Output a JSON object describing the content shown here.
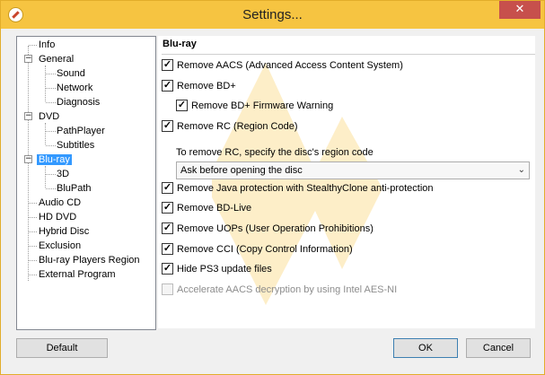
{
  "window": {
    "title": "Settings...",
    "close_glyph": "✕"
  },
  "tree": {
    "items": [
      {
        "label": "Info",
        "level": 0
      },
      {
        "label": "General",
        "level": 0,
        "expander": "−"
      },
      {
        "label": "Sound",
        "level": 1
      },
      {
        "label": "Network",
        "level": 1
      },
      {
        "label": "Diagnosis",
        "level": 1
      },
      {
        "label": "DVD",
        "level": 0,
        "expander": "−"
      },
      {
        "label": "PathPlayer",
        "level": 1
      },
      {
        "label": "Subtitles",
        "level": 1
      },
      {
        "label": "Blu-ray",
        "level": 0,
        "expander": "−",
        "selected": true
      },
      {
        "label": "3D",
        "level": 1
      },
      {
        "label": "BluPath",
        "level": 1
      },
      {
        "label": "Audio CD",
        "level": 0
      },
      {
        "label": "HD DVD",
        "level": 0
      },
      {
        "label": "Hybrid Disc",
        "level": 0
      },
      {
        "label": "Exclusion",
        "level": 0
      },
      {
        "label": "Blu-ray Players Region",
        "level": 0
      },
      {
        "label": "External Program",
        "level": 0
      }
    ]
  },
  "panel": {
    "title": "Blu-ray",
    "options": [
      {
        "label": "Remove AACS (Advanced Access Content System)",
        "checked": true
      },
      {
        "label": "Remove BD+",
        "checked": true
      },
      {
        "label": "Remove BD+ Firmware Warning",
        "checked": true
      },
      {
        "label": "Remove RC (Region Code)",
        "checked": true
      },
      {
        "label": "Remove Java protection with StealthyClone anti-protection",
        "checked": true
      },
      {
        "label": "Remove BD-Live",
        "checked": true
      },
      {
        "label": "Remove UOPs (User Operation Prohibitions)",
        "checked": true
      },
      {
        "label": "Remove CCI (Copy Control Information)",
        "checked": true
      },
      {
        "label": "Hide PS3 update files",
        "checked": true
      },
      {
        "label": "Accelerate AACS decryption by using Intel AES-NI",
        "checked": false,
        "disabled": true
      }
    ],
    "region_hint": "To remove RC, specify the disc's region code",
    "region_select": "Ask before opening the disc",
    "check_glyph": "✓",
    "chevron_glyph": "⌄"
  },
  "buttons": {
    "default": "Default",
    "ok": "OK",
    "cancel": "Cancel"
  },
  "colors": {
    "titlebar": "#f6c441",
    "selection": "#3399ff",
    "close": "#c7504c",
    "watermark": "#f7c23a"
  }
}
